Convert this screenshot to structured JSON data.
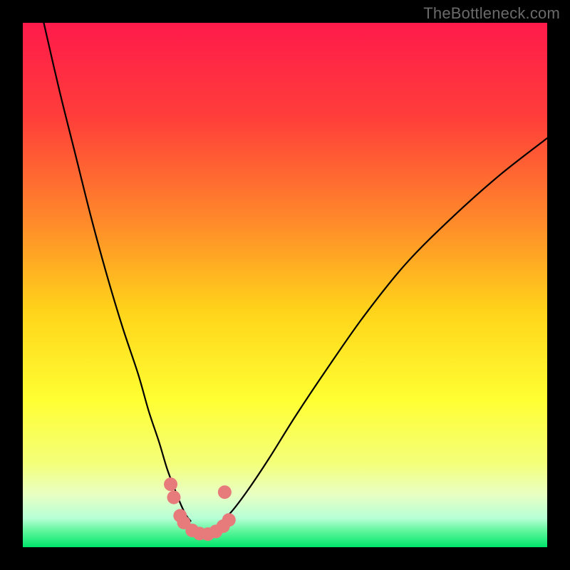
{
  "watermark": "TheBottleneck.com",
  "chart_data": {
    "type": "line",
    "title": "",
    "xlabel": "",
    "ylabel": "",
    "xlim": [
      0,
      100
    ],
    "ylim": [
      0,
      100
    ],
    "gradient_stops": [
      {
        "offset": 0.0,
        "color": "#ff1a4b"
      },
      {
        "offset": 0.18,
        "color": "#ff3e3a"
      },
      {
        "offset": 0.38,
        "color": "#ff8a2a"
      },
      {
        "offset": 0.55,
        "color": "#ffd41a"
      },
      {
        "offset": 0.72,
        "color": "#ffff33"
      },
      {
        "offset": 0.84,
        "color": "#f4ff7a"
      },
      {
        "offset": 0.9,
        "color": "#e8ffc4"
      },
      {
        "offset": 0.945,
        "color": "#b6ffd6"
      },
      {
        "offset": 0.97,
        "color": "#5cf59a"
      },
      {
        "offset": 1.0,
        "color": "#00e56b"
      }
    ],
    "series": [
      {
        "name": "bottleneck-curve-left",
        "x": [
          4.0,
          7.0,
          10.0,
          13.0,
          16.0,
          19.0,
          22.0,
          24.0,
          26.0,
          27.5,
          29.0,
          30.2,
          31.2,
          32.0
        ],
        "y": [
          100.0,
          87.0,
          75.0,
          63.0,
          52.0,
          42.0,
          33.0,
          26.0,
          20.0,
          15.0,
          11.0,
          8.0,
          6.0,
          5.0
        ]
      },
      {
        "name": "bottleneck-curve-right",
        "x": [
          38.0,
          40.0,
          43.0,
          47.0,
          52.0,
          58.0,
          65.0,
          73.0,
          82.0,
          91.0,
          100.0
        ],
        "y": [
          5.0,
          7.0,
          11.0,
          17.0,
          25.0,
          34.0,
          44.0,
          54.0,
          63.0,
          71.0,
          78.0
        ]
      }
    ],
    "marker_series": {
      "name": "bottleneck-markers",
      "color": "#e77b7b",
      "points": [
        {
          "x": 28.2,
          "y": 12.0
        },
        {
          "x": 28.8,
          "y": 9.5
        },
        {
          "x": 30.0,
          "y": 6.0
        },
        {
          "x": 30.7,
          "y": 4.7
        },
        {
          "x": 32.3,
          "y": 3.2
        },
        {
          "x": 33.7,
          "y": 2.6
        },
        {
          "x": 35.3,
          "y": 2.5
        },
        {
          "x": 36.8,
          "y": 3.0
        },
        {
          "x": 38.2,
          "y": 4.0
        },
        {
          "x": 39.3,
          "y": 5.2
        },
        {
          "x": 38.5,
          "y": 10.5
        }
      ]
    }
  }
}
